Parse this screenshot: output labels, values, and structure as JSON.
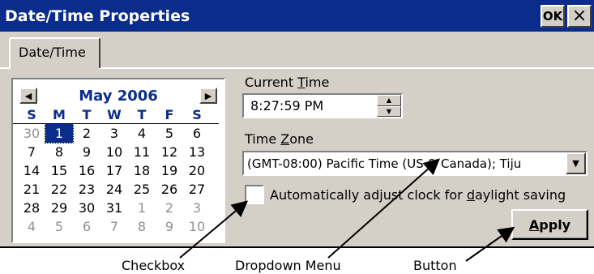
{
  "window": {
    "title": "Date/Time Properties",
    "ok_label": "OK",
    "close_label": "×",
    "tab_label": "Date/Time"
  },
  "calendar": {
    "month_title": "May 2006",
    "prev_label": "◀",
    "next_label": "▶",
    "weekdays": [
      "S",
      "M",
      "T",
      "W",
      "T",
      "F",
      "S"
    ],
    "weeks": [
      [
        "30",
        "1",
        "2",
        "3",
        "4",
        "5",
        "6"
      ],
      [
        "7",
        "8",
        "9",
        "10",
        "11",
        "12",
        "13"
      ],
      [
        "14",
        "15",
        "16",
        "17",
        "18",
        "19",
        "20"
      ],
      [
        "21",
        "22",
        "23",
        "24",
        "25",
        "26",
        "27"
      ],
      [
        "28",
        "29",
        "30",
        "31",
        "1",
        "2",
        "3"
      ],
      [
        "4",
        "5",
        "6",
        "7",
        "8",
        "9",
        "10"
      ]
    ],
    "selected_day": "1"
  },
  "time": {
    "label_pre": "Current ",
    "label_ul": "T",
    "label_post": "ime",
    "value": "8:27:59 PM",
    "spin_up": "▲",
    "spin_down": "▼"
  },
  "timezone": {
    "label_pre": "Time ",
    "label_ul": "Z",
    "label_post": "one",
    "value": "(GMT-08:00) Pacific Time (US & Canada); Tiju",
    "arrow": "▼"
  },
  "dst": {
    "label_pre": "Automatically adjust clock for ",
    "label_ul": "d",
    "label_post": "aylight saving",
    "checked": false
  },
  "apply": {
    "label_ul": "A",
    "label_post": "pply"
  },
  "callouts": {
    "checkbox": "Checkbox",
    "dropdown": "Dropdown Menu",
    "button": "Button"
  }
}
